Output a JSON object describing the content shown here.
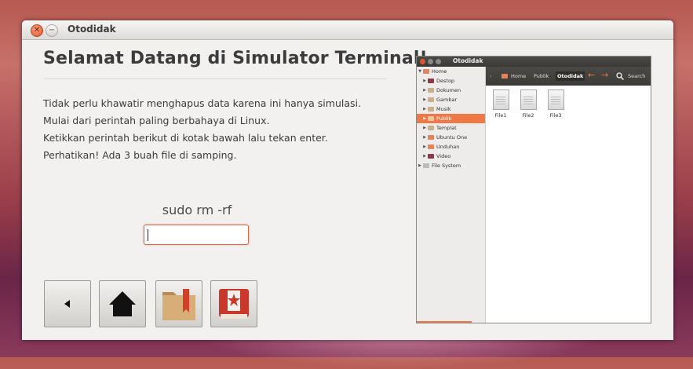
{
  "window": {
    "title": "Otodidak"
  },
  "main": {
    "heading": "Selamat Datang di Simulator Terminal!",
    "lines": [
      "Tidak perlu khawatir menghapus data karena ini hanya simulasi.",
      "Mulai dari perintah paling berbahaya di Linux.",
      "Ketikkan perintah berikut di kotak bawah lalu tekan enter.",
      "Perhatikan! Ada 3 buah file di samping."
    ],
    "command": "sudo rm -rf",
    "input_value": ""
  },
  "toolbar": {
    "buttons": [
      {
        "name": "back-button",
        "icon": "back-arrow-icon"
      },
      {
        "name": "home-button",
        "icon": "home-icon"
      },
      {
        "name": "bookmark-folder-button",
        "icon": "bookmark-folder-icon"
      },
      {
        "name": "favorite-book-button",
        "icon": "star-book-icon"
      }
    ]
  },
  "filemanager": {
    "title": "Otodidak",
    "sidebar": [
      {
        "label": "Home",
        "expanded": true,
        "selected": false
      },
      {
        "label": "Destop",
        "expanded": false,
        "selected": false
      },
      {
        "label": "Dokumen",
        "expanded": false,
        "selected": false
      },
      {
        "label": "Gambar",
        "expanded": false,
        "selected": false
      },
      {
        "label": "Musik",
        "expanded": false,
        "selected": false
      },
      {
        "label": "Publik",
        "expanded": false,
        "selected": true
      },
      {
        "label": "Templat",
        "expanded": false,
        "selected": false
      },
      {
        "label": "Ubuntu One",
        "expanded": false,
        "selected": false
      },
      {
        "label": "Unduhan",
        "expanded": false,
        "selected": false
      },
      {
        "label": "Video",
        "expanded": false,
        "selected": false
      },
      {
        "label": "File System",
        "expanded": false,
        "selected": false
      }
    ],
    "breadcrumbs": [
      "Home",
      "Publik",
      "Otodidak"
    ],
    "search_label": "Search",
    "files": [
      "File1",
      "File2",
      "File3"
    ]
  },
  "colors": {
    "accent": "#f07746",
    "close_button": "#e2542a",
    "text": "#3c3c3c"
  }
}
